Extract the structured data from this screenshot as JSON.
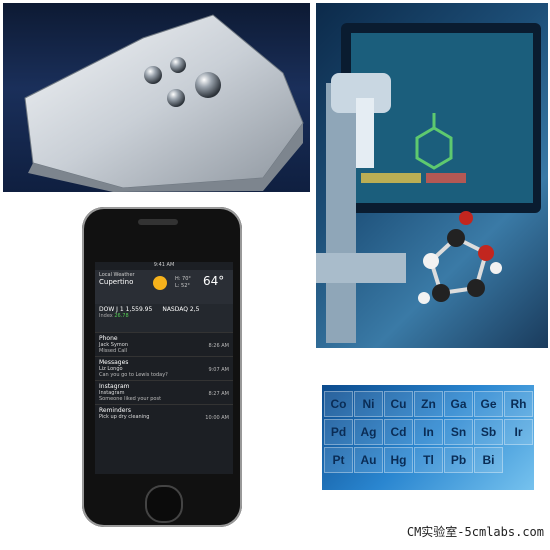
{
  "phone": {
    "status_time": "9:41 AM",
    "weather": {
      "label": "Local Weather",
      "city": "Cupertino",
      "temp": "64°",
      "high": "H: 70°",
      "low": "L: 52°"
    },
    "stocks": [
      {
        "name": "DOW J",
        "value": "1 1,559.95",
        "sub": "Index",
        "change": "26.78"
      },
      {
        "name": "NASDAQ",
        "value": "2,5",
        "sub": "",
        "change": ""
      }
    ],
    "notifications": [
      {
        "app": "Phone",
        "title": "Jack Symon",
        "body": "Missed Call",
        "time": "8:26 AM"
      },
      {
        "app": "Messages",
        "title": "Liz Longo",
        "body": "Can you go to Lewis today?",
        "time": "9:07 AM"
      },
      {
        "app": "Instagram",
        "title": "Instagram",
        "body": "Someone liked your post",
        "time": "8:27 AM"
      },
      {
        "app": "Reminders",
        "title": "Pick up dry cleaning",
        "body": "",
        "time": "10:00 AM"
      }
    ]
  },
  "periodic": {
    "elements": [
      "Co",
      "Ni",
      "Cu",
      "Zn",
      "Ga",
      "Ge",
      "Rh",
      "Pd",
      "Ag",
      "Cd",
      "In",
      "Sn",
      "Sb",
      "Ir",
      "Pt",
      "Au",
      "Hg",
      "Tl",
      "Pb",
      "Bi"
    ]
  },
  "watermark": "CM实验室-5cmlabs.com"
}
